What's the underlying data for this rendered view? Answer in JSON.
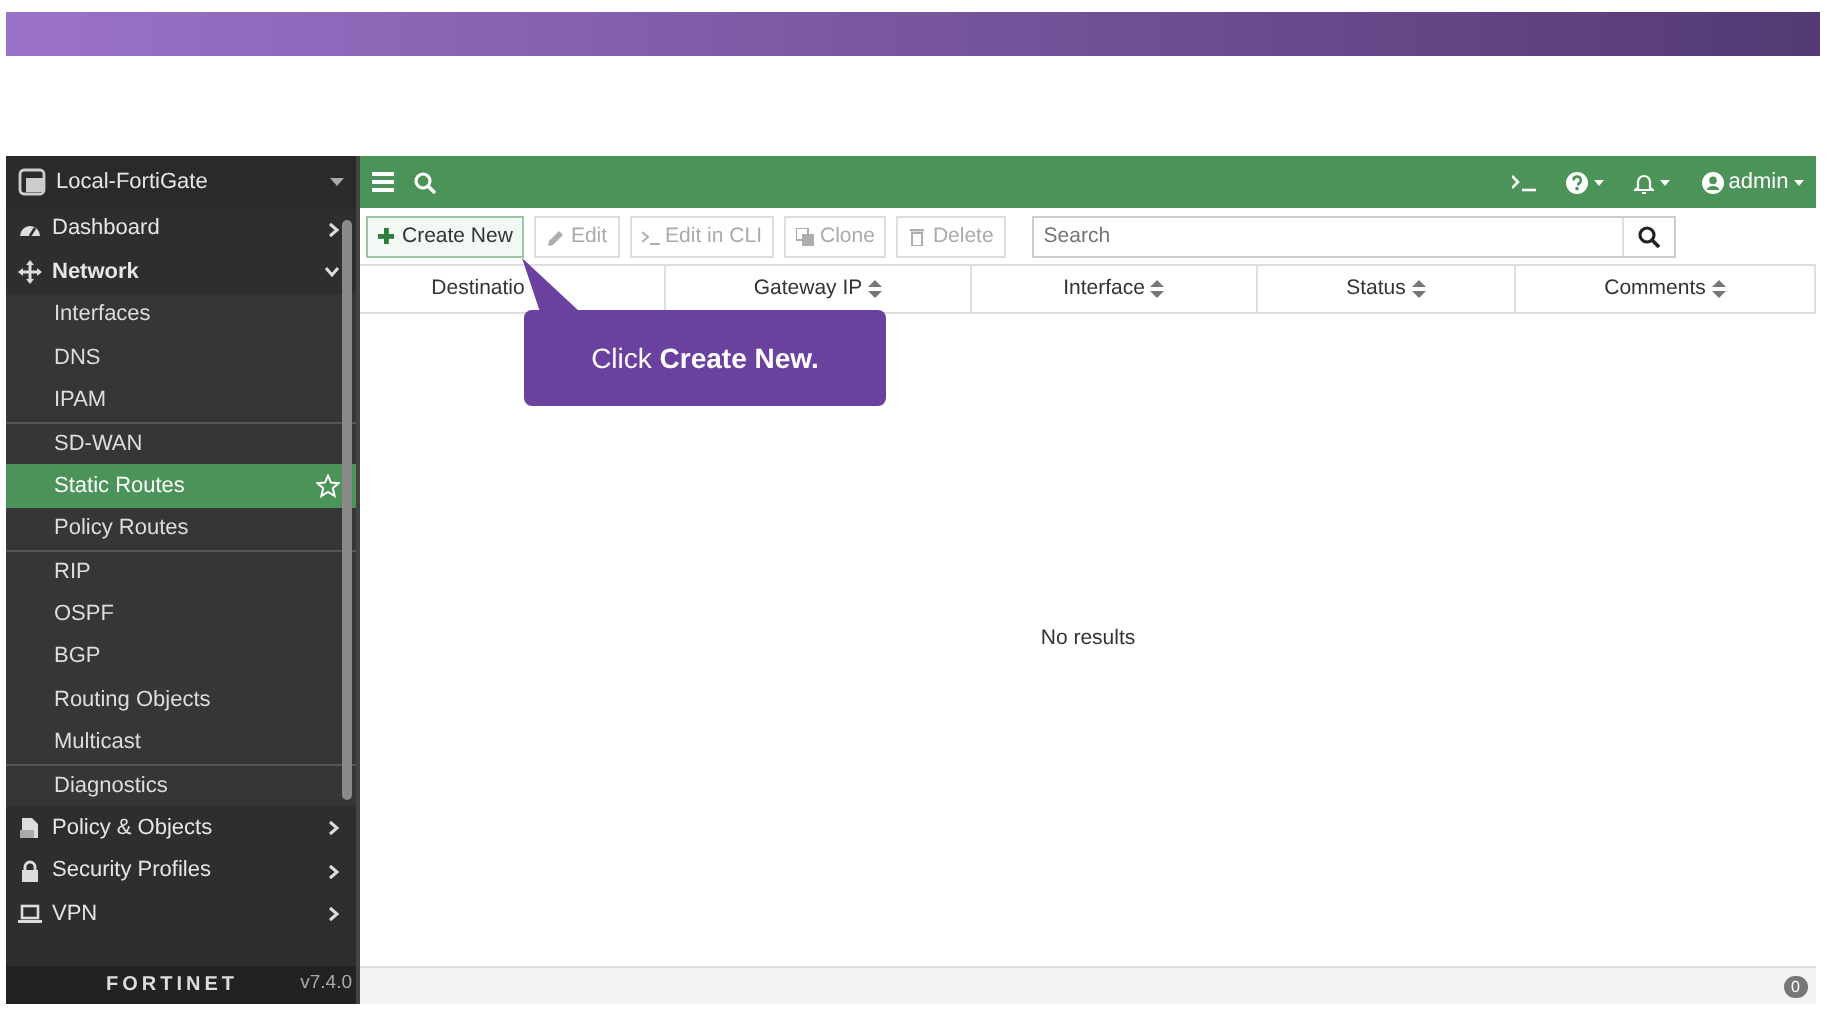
{
  "device": {
    "name": "Local-FortiGate"
  },
  "sidebar": {
    "items": [
      {
        "label": "Dashboard",
        "expanded": false
      },
      {
        "label": "Network",
        "expanded": true,
        "children": [
          {
            "label": "Interfaces",
            "selected": false,
            "separator_before": false
          },
          {
            "label": "DNS",
            "selected": false,
            "separator_before": false
          },
          {
            "label": "IPAM",
            "selected": false,
            "separator_before": false
          },
          {
            "label": "SD-WAN",
            "selected": false,
            "separator_before": true
          },
          {
            "label": "Static Routes",
            "selected": true,
            "separator_before": false
          },
          {
            "label": "Policy Routes",
            "selected": false,
            "separator_before": false
          },
          {
            "label": "RIP",
            "selected": false,
            "separator_before": true
          },
          {
            "label": "OSPF",
            "selected": false,
            "separator_before": false
          },
          {
            "label": "BGP",
            "selected": false,
            "separator_before": false
          },
          {
            "label": "Routing Objects",
            "selected": false,
            "separator_before": false
          },
          {
            "label": "Multicast",
            "selected": false,
            "separator_before": false
          },
          {
            "label": "Diagnostics",
            "selected": false,
            "separator_before": true
          }
        ]
      },
      {
        "label": "Policy & Objects",
        "expanded": false
      },
      {
        "label": "Security Profiles",
        "expanded": false
      },
      {
        "label": "VPN",
        "expanded": false
      }
    ]
  },
  "footer": {
    "logo": "FORTINET",
    "version": "v7.4.0"
  },
  "topbar": {
    "user": "admin"
  },
  "toolbar": {
    "buttons": [
      {
        "label": "Create New",
        "disabled": false
      },
      {
        "label": "Edit",
        "disabled": true
      },
      {
        "label": "Edit in CLI",
        "disabled": true
      },
      {
        "label": "Clone",
        "disabled": true
      },
      {
        "label": "Delete",
        "disabled": true
      }
    ],
    "search": {
      "placeholder": "Search"
    }
  },
  "table": {
    "columns": [
      "Destinatio",
      "Gateway IP",
      "Interface",
      "Status",
      "Comments"
    ],
    "empty_message": "No results"
  },
  "callout": {
    "text": "Click **Create New.**"
  },
  "status_bar": {
    "badge": "0"
  }
}
